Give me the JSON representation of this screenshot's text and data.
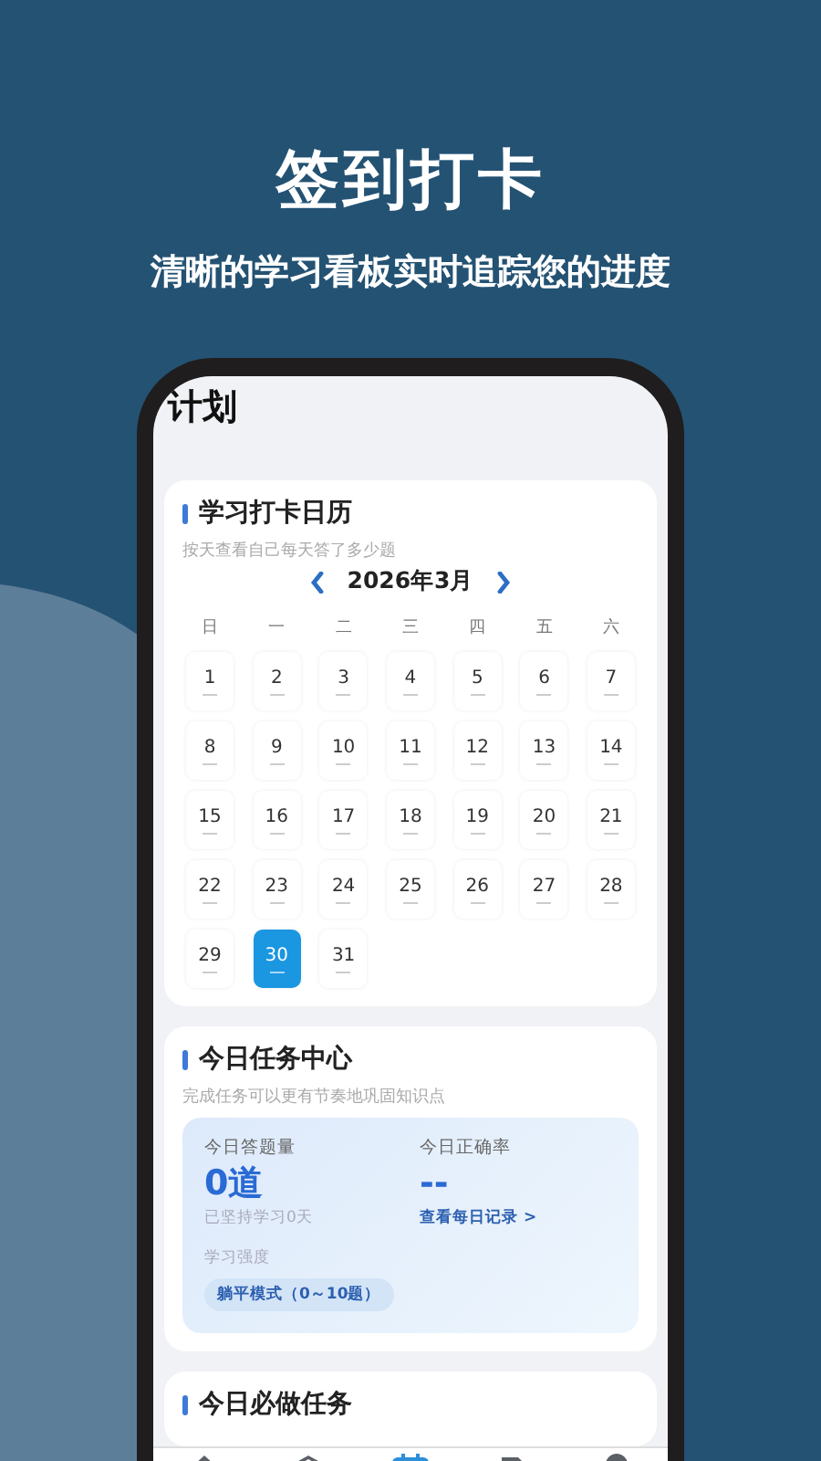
{
  "headline": "签到打卡",
  "subheadline": "清晰的学习看板实时追踪您的进度",
  "screen": {
    "title": "计划",
    "calendar_card": {
      "title": "学习打卡日历",
      "subtitle": "按天查看自己每天答了多少题",
      "month": "2026年3月",
      "weekdays": [
        "日",
        "一",
        "二",
        "三",
        "四",
        "五",
        "六"
      ],
      "days": [
        {
          "label": "1",
          "selected": false
        },
        {
          "label": "2",
          "selected": false
        },
        {
          "label": "3",
          "selected": false
        },
        {
          "label": "4",
          "selected": false
        },
        {
          "label": "5",
          "selected": false
        },
        {
          "label": "6",
          "selected": false
        },
        {
          "label": "7",
          "selected": false
        },
        {
          "label": "8",
          "selected": false
        },
        {
          "label": "9",
          "selected": false
        },
        {
          "label": "10",
          "selected": false
        },
        {
          "label": "11",
          "selected": false
        },
        {
          "label": "12",
          "selected": false
        },
        {
          "label": "13",
          "selected": false
        },
        {
          "label": "14",
          "selected": false
        },
        {
          "label": "15",
          "selected": false
        },
        {
          "label": "16",
          "selected": false
        },
        {
          "label": "17",
          "selected": false
        },
        {
          "label": "18",
          "selected": false
        },
        {
          "label": "19",
          "selected": false
        },
        {
          "label": "20",
          "selected": false
        },
        {
          "label": "21",
          "selected": false
        },
        {
          "label": "22",
          "selected": false
        },
        {
          "label": "23",
          "selected": false
        },
        {
          "label": "24",
          "selected": false
        },
        {
          "label": "25",
          "selected": false
        },
        {
          "label": "26",
          "selected": false
        },
        {
          "label": "27",
          "selected": false
        },
        {
          "label": "28",
          "selected": false
        },
        {
          "label": "29",
          "selected": false
        },
        {
          "label": "30",
          "selected": true
        },
        {
          "label": "31",
          "selected": false
        }
      ]
    },
    "task_center_card": {
      "title": "今日任务中心",
      "subtitle": "完成任务可以更有节奏地巩固知识点",
      "answered_label": "今日答题量",
      "answered_value": "0道",
      "streak": "已坚持学习0天",
      "intensity_label": "学习强度",
      "intensity_mode": "躺平模式（0～10题）",
      "accuracy_label": "今日正确率",
      "accuracy_value": "--",
      "records_link": "查看每日记录 >"
    },
    "required_tasks_card": {
      "title": "今日必做任务"
    },
    "tab_bar": [
      {
        "kind": "home",
        "selected": false
      },
      {
        "kind": "layers",
        "selected": false
      },
      {
        "kind": "calendar",
        "selected": true
      },
      {
        "kind": "document",
        "selected": false
      },
      {
        "kind": "profile",
        "selected": false
      }
    ]
  }
}
